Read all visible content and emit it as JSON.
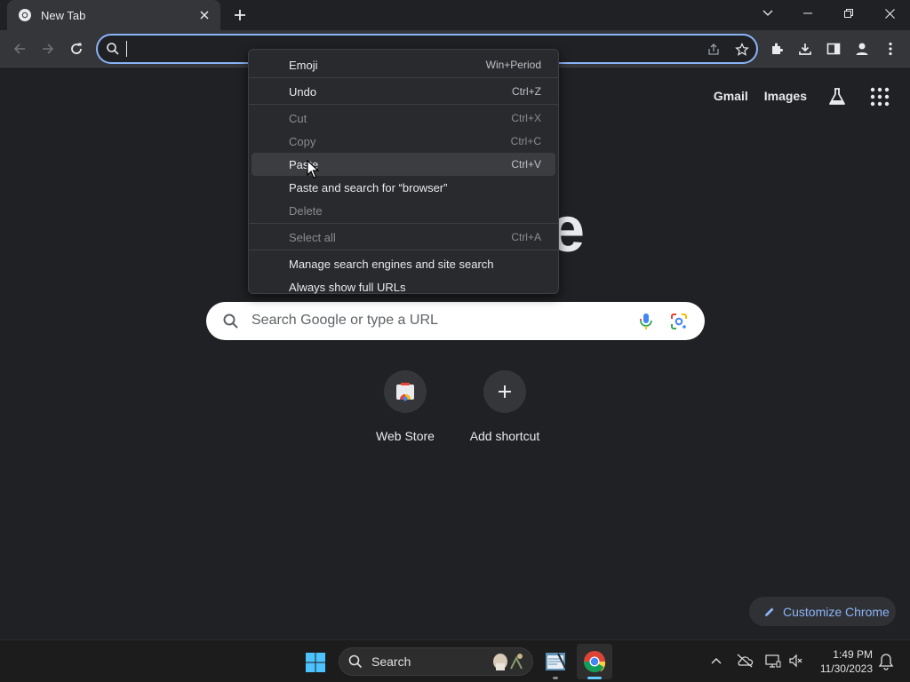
{
  "tab": {
    "title": "New Tab",
    "close_icon": "close-icon",
    "favicon": "chrome-icon"
  },
  "omnibox": {
    "value": "",
    "placeholder": ""
  },
  "ntp": {
    "gmail": "Gmail",
    "images": "Images",
    "logo_fragment": "e",
    "search_placeholder": "Search Google or type a URL",
    "shortcuts": [
      {
        "label": "Web Store"
      },
      {
        "label": "Add shortcut"
      }
    ],
    "customize": "Customize Chrome"
  },
  "context_menu": {
    "items": [
      {
        "label": "Emoji",
        "shortcut": "Win+Period",
        "disabled": false
      },
      {
        "label": "Undo",
        "shortcut": "Ctrl+Z",
        "disabled": false
      },
      {
        "label": "Cut",
        "shortcut": "Ctrl+X",
        "disabled": true
      },
      {
        "label": "Copy",
        "shortcut": "Ctrl+C",
        "disabled": true
      },
      {
        "label": "Paste",
        "shortcut": "Ctrl+V",
        "disabled": false,
        "hovered": true
      },
      {
        "label": "Paste and search for “browser”",
        "shortcut": "",
        "disabled": false
      },
      {
        "label": "Delete",
        "shortcut": "",
        "disabled": true
      },
      {
        "label": "Select all",
        "shortcut": "Ctrl+A",
        "disabled": true
      },
      {
        "label": "Manage search engines and site search",
        "shortcut": "",
        "disabled": false
      },
      {
        "label": "Always show full URLs",
        "shortcut": "",
        "disabled": false
      }
    ]
  },
  "taskbar": {
    "search_label": "Search",
    "time": "1:49 PM",
    "date": "11/30/2023"
  },
  "colors": {
    "accent": "#8ab4f8",
    "background": "#202124",
    "toolbar": "#35363a",
    "menu": "#292a2d"
  }
}
